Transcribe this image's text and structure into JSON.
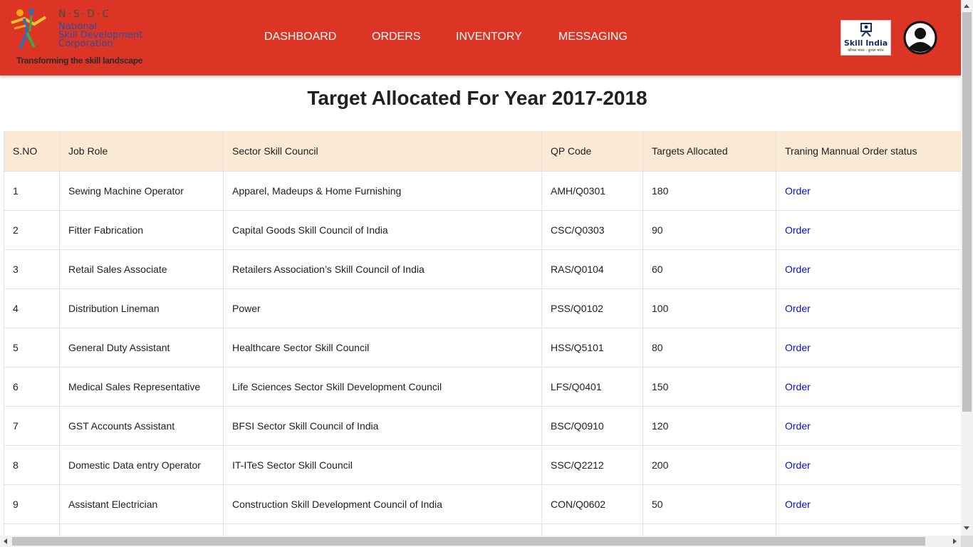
{
  "header": {
    "logo": {
      "acronym": "N·S·D·C",
      "line1": "National",
      "line2": "Skill Development",
      "line3": "Corporation",
      "tagline": "Transforming the skill landscape"
    },
    "nav": [
      "DASHBOARD",
      "ORDERS",
      "INVENTORY",
      "MESSAGING"
    ],
    "skill_india": {
      "title": "Skill India",
      "subtitle": "कौशल भारत - कुशल भारत"
    },
    "avatar_icon": "user-circle-icon"
  },
  "page_title": "Target Allocated For Year 2017-2018",
  "table": {
    "columns": [
      "S.NO",
      "Job Role",
      "Sector Skill Council",
      "QP Code",
      "Targets Allocated",
      "Traning Mannual Order status"
    ],
    "rows": [
      {
        "sno": "1",
        "job_role": "Sewing Machine Operator",
        "ssc": "Apparel, Madeups & Home Furnishing",
        "qp": "AMH/Q0301",
        "target": "180",
        "status": "Order"
      },
      {
        "sno": "2",
        "job_role": "Fitter Fabrication",
        "ssc": "Capital Goods Skill Council of India",
        "qp": "CSC/Q0303",
        "target": "90",
        "status": "Order"
      },
      {
        "sno": "3",
        "job_role": "Retail Sales Associate",
        "ssc": "Retailers Association’s Skill Council of India",
        "qp": "RAS/Q0104",
        "target": "60",
        "status": "Order"
      },
      {
        "sno": "4",
        "job_role": "Distribution Lineman",
        "ssc": "Power",
        "qp": "PSS/Q0102",
        "target": "100",
        "status": "Order"
      },
      {
        "sno": "5",
        "job_role": "General Duty Assistant",
        "ssc": "Healthcare Sector Skill Council",
        "qp": "HSS/Q5101",
        "target": "80",
        "status": "Order"
      },
      {
        "sno": "6",
        "job_role": "Medical Sales Representative",
        "ssc": "Life Sciences Sector Skill Development Council",
        "qp": "LFS/Q0401",
        "target": "150",
        "status": "Order"
      },
      {
        "sno": "7",
        "job_role": "GST Accounts Assistant",
        "ssc": "BFSI Sector Skill Council of India",
        "qp": "BSC/Q0910",
        "target": "120",
        "status": "Order"
      },
      {
        "sno": "8",
        "job_role": "Domestic Data entry Operator",
        "ssc": "IT-ITeS Sector Skill Council",
        "qp": "SSC/Q2212",
        "target": "200",
        "status": "Order"
      },
      {
        "sno": "9",
        "job_role": "Assistant Electrician",
        "ssc": "Construction Skill Development Council of India",
        "qp": "CON/Q0602",
        "target": "50",
        "status": "Order"
      },
      {
        "sno": "",
        "job_role": "",
        "ssc": "",
        "qp": "",
        "target": "",
        "status": ""
      }
    ]
  },
  "colors": {
    "header_bg": "#dc3425",
    "table_header_bg": "#f9e9d5",
    "link": "#0b0bd8"
  }
}
